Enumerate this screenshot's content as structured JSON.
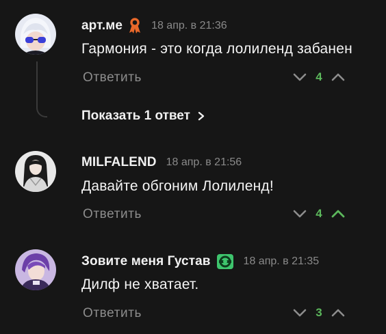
{
  "comments": [
    {
      "author": "арт.ме",
      "time": "18 апр. в 21:36",
      "text": "Гармония - это когда лолиленд забанен",
      "reply_label": "Ответить",
      "votes": "4",
      "badge_icon": "orange-ribbon-icon",
      "show_replies_label": "Показать 1 ответ"
    },
    {
      "author": "MILFALEND",
      "time": "18 апр. в 21:56",
      "text": "Давайте обгоним Лолиленд!",
      "reply_label": "Ответить",
      "votes": "4",
      "upvote_active": true
    },
    {
      "author": "Зовите меня Густав",
      "time": "18 апр. в 21:35",
      "text": "Дилф не хватает.",
      "reply_label": "Ответить",
      "votes": "3",
      "badge_icon": "green-lantern-icon"
    }
  ],
  "colors": {
    "background": "#161616",
    "vote_count": "#5cb85c",
    "muted": "#8d8d8d",
    "ribbon": "#e8682a",
    "badge_green": "#3ec46d"
  }
}
